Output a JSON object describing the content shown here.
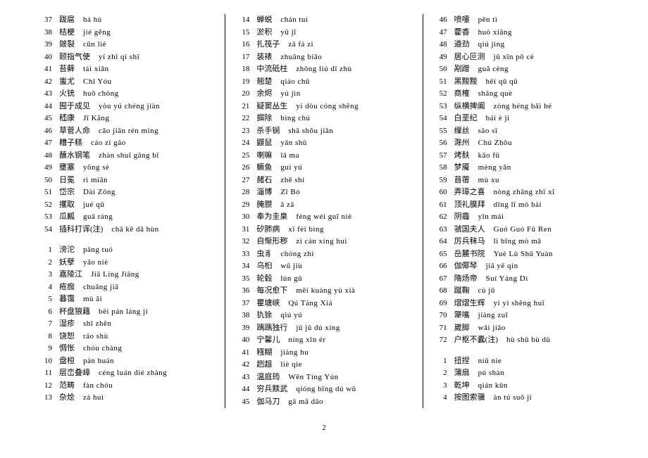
{
  "page_number": "2",
  "columns": [
    {
      "groups": [
        [
          {
            "n": "37",
            "t": "跋扈",
            "p": "bá hù"
          },
          {
            "n": "38",
            "t": "桔梗",
            "p": "jié gěng"
          },
          {
            "n": "39",
            "t": "皴裂",
            "p": "cūn liè"
          },
          {
            "n": "40",
            "t": "颐指气使",
            "p": "yí zhǐ qì shǐ"
          },
          {
            "n": "41",
            "t": "苔藓",
            "p": "tái xiǎn"
          },
          {
            "n": "42",
            "t": "蚩尤",
            "p": "Chī Yóu"
          },
          {
            "n": "43",
            "t": "火铳",
            "p": "huǒ chòng"
          },
          {
            "n": "44",
            "t": "囿于成见",
            "p": "yòu yú chéng jiàn"
          },
          {
            "n": "45",
            "t": "嵇康",
            "p": "Jī Kāng"
          },
          {
            "n": "46",
            "t": "草菅人命",
            "p": "cǎo jiān rén mìng"
          },
          {
            "n": "47",
            "t": "糟子糕",
            "p": "cáo zi gāo"
          },
          {
            "n": "48",
            "t": "蘸水钢笔",
            "p": "zhàn shuǐ gāng bǐ"
          },
          {
            "n": "49",
            "t": "壅塞",
            "p": "yōng sè"
          },
          {
            "n": "50",
            "t": "日冕",
            "p": "rì miǎn"
          },
          {
            "n": "51",
            "t": "岱宗",
            "p": "Dài Zōng"
          },
          {
            "n": "52",
            "t": "攫取",
            "p": "jué qǔ"
          },
          {
            "n": "53",
            "t": "瓜瓤",
            "p": "guā ráng"
          },
          {
            "n": "54",
            "t": "插科打诨(注)",
            "p": "chā kē dǎ hùn"
          }
        ],
        [
          {
            "n": "1",
            "t": "滂沱",
            "p": "pāng tuó"
          },
          {
            "n": "2",
            "t": "妖孽",
            "p": "yāo niè"
          },
          {
            "n": "3",
            "t": "嘉陵江",
            "p": "Jiā Líng Jiāng"
          },
          {
            "n": "4",
            "t": "疮痂",
            "p": "chuāng jiā"
          },
          {
            "n": "5",
            "t": "暮霭",
            "p": "mù ǎi"
          },
          {
            "n": "6",
            "t": "杯盘狼藉",
            "p": "bēi pán láng jí"
          },
          {
            "n": "7",
            "t": "湿疹",
            "p": "shī zhěn"
          },
          {
            "n": "8",
            "t": "饶恕",
            "p": "ráo shù"
          },
          {
            "n": "9",
            "t": "惆怅",
            "p": "chóu chàng"
          },
          {
            "n": "10",
            "t": "盘桓",
            "p": "pán huán"
          },
          {
            "n": "11",
            "t": "层峦叠嶂",
            "p": "céng luán dié zhàng"
          },
          {
            "n": "12",
            "t": "范畴",
            "p": "fàn chóu"
          },
          {
            "n": "13",
            "t": "杂烩",
            "p": "zá huì"
          }
        ]
      ]
    },
    {
      "groups": [
        [
          {
            "n": "14",
            "t": "蝉蜕",
            "p": "chán tuì"
          },
          {
            "n": "15",
            "t": "淤积",
            "p": "yū jī"
          },
          {
            "n": "16",
            "t": "扎筏子",
            "p": "zā fá zi"
          },
          {
            "n": "17",
            "t": "装裱",
            "p": "zhuāng biǎo"
          },
          {
            "n": "18",
            "t": "中流砥柱",
            "p": "zhōng liú dǐ zhù"
          },
          {
            "n": "19",
            "t": "翘楚",
            "p": "qiáo chǔ"
          },
          {
            "n": "20",
            "t": "余烬",
            "p": "yú jìn"
          },
          {
            "n": "21",
            "t": "疑窦丛生",
            "p": "yí dòu cóng shēng"
          },
          {
            "n": "22",
            "t": "摒除",
            "p": "bìng chú"
          },
          {
            "n": "23",
            "t": "杀手锏",
            "p": "shā shǒu jiǎn"
          },
          {
            "n": "24",
            "t": "鼹鼠",
            "p": "yǎn shǔ"
          },
          {
            "n": "25",
            "t": "喇嘛",
            "p": "lǎ ma"
          },
          {
            "n": "26",
            "t": "鳜鱼",
            "p": "guì yú"
          },
          {
            "n": "27",
            "t": "赭石",
            "p": "zhě shí"
          },
          {
            "n": "28",
            "t": "淄博",
            "p": "Zī Bó"
          },
          {
            "n": "29",
            "t": "腌臜",
            "p": "ā zā"
          },
          {
            "n": "30",
            "t": "奉为圭臬",
            "p": "fèng wéi guī niè"
          },
          {
            "n": "31",
            "t": "矽肺病",
            "p": "xī fèi bìng"
          },
          {
            "n": "32",
            "t": "自惭形秽",
            "p": "zì cán xíng huì"
          },
          {
            "n": "33",
            "t": "虫豸",
            "p": "chóng zhì"
          },
          {
            "n": "34",
            "t": "乌桕",
            "p": "wū jiù"
          },
          {
            "n": "35",
            "t": "轮毂",
            "p": "lún gǔ"
          },
          {
            "n": "36",
            "t": "每况愈下",
            "p": "měi kuàng yù xià"
          },
          {
            "n": "37",
            "t": "瞿塘峡",
            "p": "Qú Táng Xiá"
          },
          {
            "n": "38",
            "t": "犰狳",
            "p": "qiú yú"
          },
          {
            "n": "39",
            "t": "踽踽独行",
            "p": "jǔ jǔ dú xíng"
          },
          {
            "n": "40",
            "t": "宁馨儿",
            "p": "níng xīn ér"
          },
          {
            "n": "41",
            "t": "糨糊",
            "p": "jiàng hu"
          },
          {
            "n": "42",
            "t": "趔趄",
            "p": "liè qie"
          },
          {
            "n": "43",
            "t": "温庭筠",
            "p": "Wēn Tíng Yún"
          },
          {
            "n": "44",
            "t": "穷兵黩武",
            "p": "qióng bīng dú wǔ"
          },
          {
            "n": "45",
            "t": "伽马刀",
            "p": "gā mǎ dāo"
          }
        ]
      ]
    },
    {
      "groups": [
        [
          {
            "n": "46",
            "t": "喷嚏",
            "p": "pēn tì"
          },
          {
            "n": "47",
            "t": "藿香",
            "p": "huò xiāng"
          },
          {
            "n": "48",
            "t": "遒劲",
            "p": "qiú jìng"
          },
          {
            "n": "49",
            "t": "居心叵测",
            "p": "jū xīn pǒ cè"
          },
          {
            "n": "50",
            "t": "剐蹭",
            "p": "guǎ cèng"
          },
          {
            "n": "51",
            "t": "黑黢黢",
            "p": "hēi qū qū"
          },
          {
            "n": "52",
            "t": "商榷",
            "p": "shāng què"
          },
          {
            "n": "53",
            "t": "纵横捭阖",
            "p": "zòng héng bǎi hé"
          },
          {
            "n": "54",
            "t": "白垩纪",
            "p": "bái è jì"
          },
          {
            "n": "55",
            "t": "缫丝",
            "p": "sāo sī"
          },
          {
            "n": "56",
            "t": "滁州",
            "p": "Chú Zhōu"
          },
          {
            "n": "57",
            "t": "烤麸",
            "p": "kǎo fū"
          },
          {
            "n": "58",
            "t": "梦魇",
            "p": "mèng yǎn"
          },
          {
            "n": "59",
            "t": "苜蓿",
            "p": "mù xu"
          },
          {
            "n": "60",
            "t": "弄璋之喜",
            "p": "nòng zhāng zhī xǐ"
          },
          {
            "n": "61",
            "t": "顶礼膜拜",
            "p": "dǐng lǐ mó bài"
          },
          {
            "n": "62",
            "t": "阴霾",
            "p": "yīn mái"
          },
          {
            "n": "63",
            "t": "虢国夫人",
            "p": "Guó Guó Fū Ren"
          },
          {
            "n": "64",
            "t": "厉兵秣马",
            "p": "lì bīng mò mǎ"
          },
          {
            "n": "65",
            "t": "岳麓书院",
            "p": "Yuè Lù Shū Yuàn"
          },
          {
            "n": "66",
            "t": "伽倻琴",
            "p": "jiā yē qín"
          },
          {
            "n": "67",
            "t": "隋炀帝",
            "p": "Suí Yáng Dì"
          },
          {
            "n": "68",
            "t": "蹴鞠",
            "p": "cù jū"
          },
          {
            "n": "69",
            "t": "熠熠生辉",
            "p": "yì yì shēng huī"
          },
          {
            "n": "70",
            "t": "犟嘴",
            "p": "jiàng zuǐ"
          },
          {
            "n": "71",
            "t": "崴脚",
            "p": "wǎi jiǎo"
          },
          {
            "n": "72",
            "t": "户枢不蠹(注)",
            "p": "hù shū bù dù"
          }
        ],
        [
          {
            "n": "1",
            "t": "扭捏",
            "p": "niǔ nie"
          },
          {
            "n": "2",
            "t": "蒲扇",
            "p": "pú shàn"
          },
          {
            "n": "3",
            "t": "乾坤",
            "p": "qián kūn"
          },
          {
            "n": "4",
            "t": "按图索骥",
            "p": "àn tú suǒ jì"
          }
        ]
      ]
    }
  ]
}
